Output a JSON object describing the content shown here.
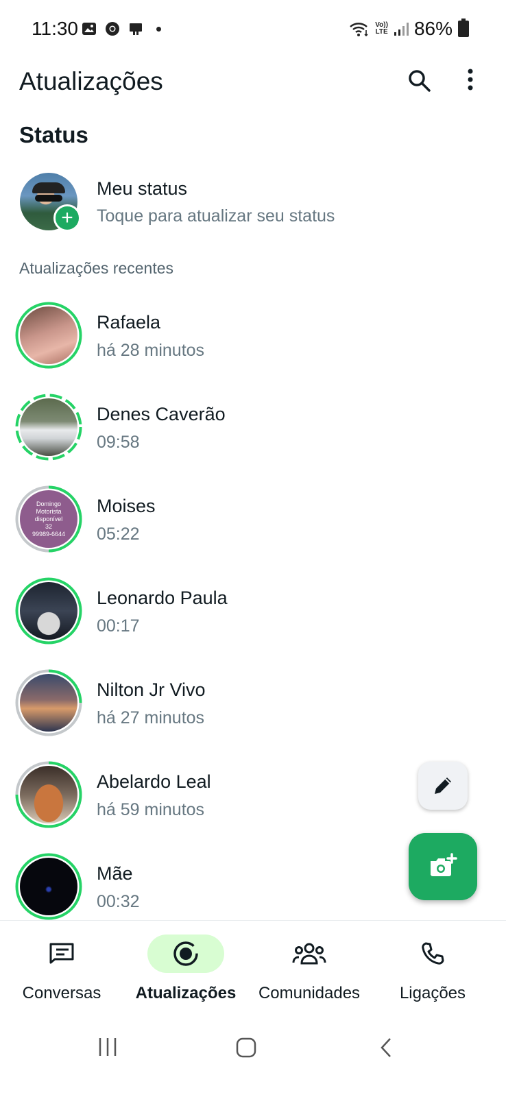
{
  "statusbar": {
    "time": "11:30",
    "battery": "86%",
    "icons_left": [
      "gallery-icon",
      "chrome-icon",
      "device-icon",
      "notification-dot"
    ],
    "icons_right": [
      "wifi-icon",
      "volte-icon",
      "signal-icon",
      "battery-icon"
    ],
    "volte_top": "Vo))",
    "volte_bottom": "LTE"
  },
  "appbar": {
    "title": "Atualizações",
    "search_icon": "search-icon",
    "more_icon": "more-vert-icon"
  },
  "section_title": "Status",
  "my_status": {
    "name": "Meu status",
    "subtitle": "Toque para atualizar seu status",
    "badge": "+"
  },
  "recent_label": "Atualizações recentes",
  "statuses": [
    {
      "name": "Rafaela",
      "time": "há 28 minutos",
      "ring": "single-green"
    },
    {
      "name": "Denes Caverão",
      "time": "09:58",
      "ring": "segmented-green"
    },
    {
      "name": "Moises",
      "time": "05:22",
      "ring": "partial-seen",
      "thumb_lines": [
        "Domingo",
        "Motorista",
        "disponível",
        "32",
        "99989-6644"
      ]
    },
    {
      "name": "Leonardo Paula",
      "time": "00:17",
      "ring": "single-green"
    },
    {
      "name": "Nilton Jr Vivo",
      "time": "há 27 minutos",
      "ring": "partial-seen"
    },
    {
      "name": "Abelardo Leal",
      "time": "há 59 minutos",
      "ring": "partial-seen"
    },
    {
      "name": "Mãe",
      "time": "00:32",
      "ring": "single-green"
    }
  ],
  "fabs": {
    "edit_icon": "pencil-icon",
    "camera_icon": "camera-add-icon"
  },
  "nav": {
    "items": [
      {
        "label": "Conversas",
        "icon": "chat-icon",
        "active": false
      },
      {
        "label": "Atualizações",
        "icon": "status-icon",
        "active": true
      },
      {
        "label": "Comunidades",
        "icon": "communities-icon",
        "active": false
      },
      {
        "label": "Ligações",
        "icon": "phone-icon",
        "active": false
      }
    ]
  },
  "colors": {
    "accent": "#1daa61",
    "active_pill": "#d8fdd2",
    "text_primary": "#111b21",
    "text_secondary": "#667781",
    "seen_ring": "#c4c8cb"
  }
}
